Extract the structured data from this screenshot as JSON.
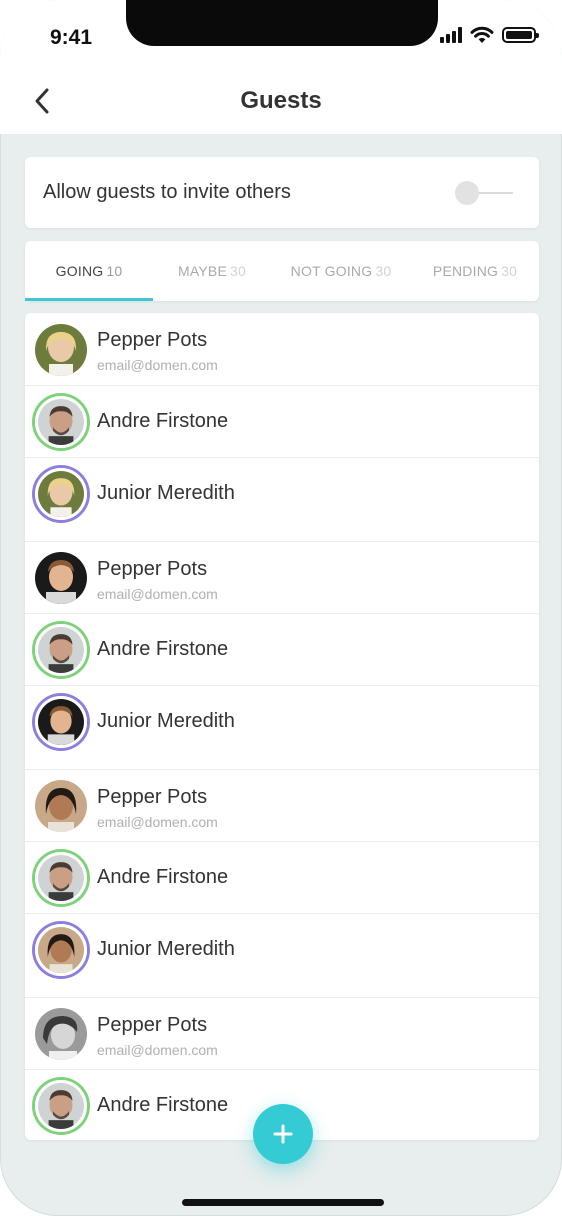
{
  "status_bar": {
    "time": "9:41"
  },
  "header": {
    "title": "Guests"
  },
  "settings": {
    "allow_invite_label": "Allow guests to invite others",
    "allow_invite_enabled": false
  },
  "tabs": [
    {
      "label": "GOING",
      "count": "10",
      "active": true
    },
    {
      "label": "MAYBE",
      "count": "30",
      "active": false
    },
    {
      "label": "NOT GOING",
      "count": "30",
      "active": false
    },
    {
      "label": "PENDING",
      "count": "30",
      "active": false
    }
  ],
  "guests": [
    {
      "name": "Pepper Pots",
      "email": "email@domen.com"
    },
    {
      "name": "Andre Firstone"
    },
    {
      "name": "Junior Meredith"
    },
    {
      "name": "Pepper Pots",
      "email": "email@domen.com"
    },
    {
      "name": "Andre Firstone"
    },
    {
      "name": "Junior Meredith"
    },
    {
      "name": "Pepper Pots",
      "email": "email@domen.com"
    },
    {
      "name": "Andre Firstone"
    },
    {
      "name": "Junior Meredith"
    },
    {
      "name": "Pepper Pots",
      "email": "email@domen.com"
    },
    {
      "name": "Andre Firstone"
    }
  ],
  "colors": {
    "accent": "#35cbd4",
    "ring_green": "#7fd17a",
    "ring_purple": "#8c7fe0",
    "background": "#e8eded"
  },
  "icons": {
    "back": "chevron-left-icon",
    "add": "plus-icon",
    "signal": "cellular-signal-icon",
    "wifi": "wifi-icon",
    "battery": "battery-icon"
  }
}
